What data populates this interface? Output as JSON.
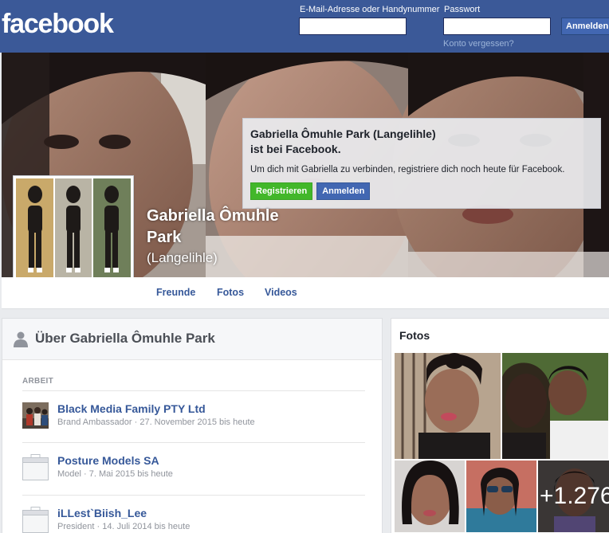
{
  "header": {
    "logo": "facebook",
    "email_label": "E-Mail-Adresse oder Handynummer",
    "password_label": "Passwort",
    "login_button": "Anmelden",
    "forgot_link": "Konto vergessen?",
    "email_value": "",
    "password_value": ""
  },
  "cta": {
    "title_line1": "Gabriella Ômuhle Park (Langelihle)",
    "title_line2": "ist bei Facebook.",
    "text": "Um dich mit Gabriella zu verbinden, registriere dich noch heute für Facebook.",
    "register_button": "Registrieren",
    "login_button": "Anmelden"
  },
  "profile": {
    "name": "Gabriella Ômuhle Park",
    "alternate_name": "(Langelihle)"
  },
  "tabs": [
    "Freunde",
    "Fotos",
    "Videos"
  ],
  "about": {
    "title": "Über Gabriella Ômuhle Park",
    "section_label": "ARBEIT",
    "work": [
      {
        "name": "Black Media Family PTY Ltd",
        "meta": "Brand Ambassador · 27. November 2015 bis heute",
        "icon": "company-photo"
      },
      {
        "name": "Posture Models SA",
        "meta": "Model · 7. Mai 2015 bis heute",
        "icon": "workplace-placeholder-icon"
      },
      {
        "name": "iLLest`Biish_Lee",
        "meta": "President · 14. Juli 2014 bis heute",
        "icon": "workplace-placeholder-icon"
      }
    ]
  },
  "photos": {
    "title": "Fotos",
    "more_count": "+1.276"
  },
  "colors": {
    "brand_blue": "#3b5998",
    "button_blue": "#4267b2",
    "button_green": "#42b72a",
    "link_blue": "#365899"
  }
}
